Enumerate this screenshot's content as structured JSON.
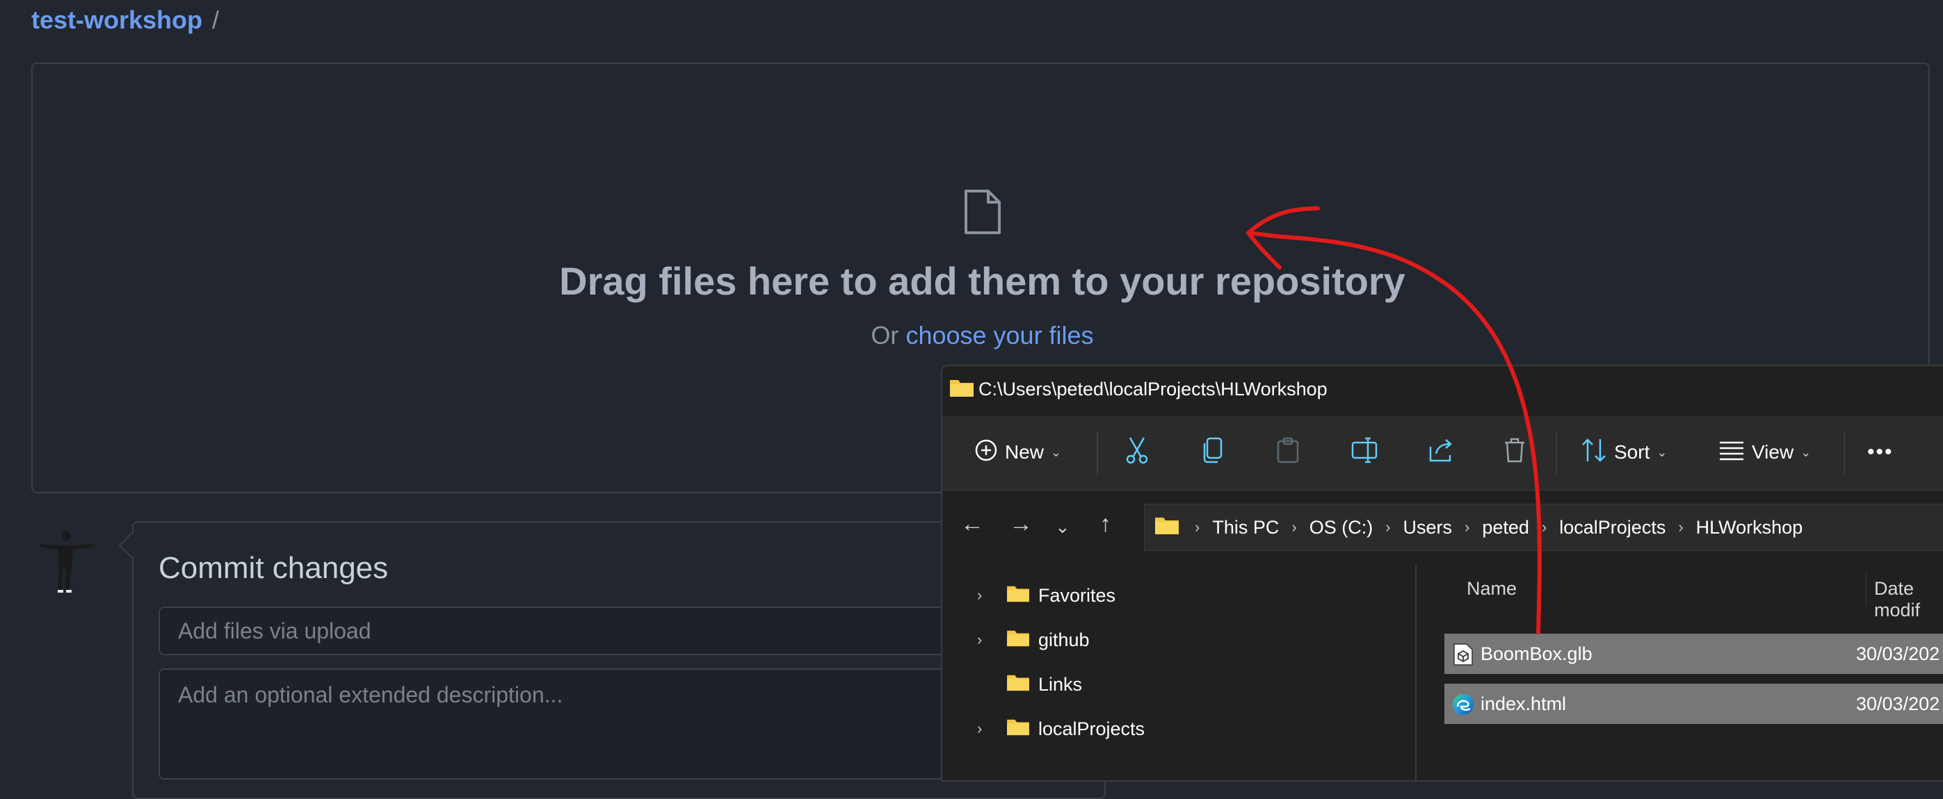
{
  "breadcrumb": {
    "repo": "test-workshop",
    "separator": "/"
  },
  "dropzone": {
    "title": "Drag files here to add them to your repository",
    "sub_prefix": "Or",
    "sub_link": "choose your files"
  },
  "commit": {
    "title": "Commit changes",
    "summary_placeholder": "Add files via upload",
    "description_placeholder": "Add an optional extended description..."
  },
  "explorer": {
    "title": "C:\\Users\\peted\\localProjects\\HLWorkshop",
    "toolbar": {
      "new_label": "New",
      "sort_label": "Sort",
      "view_label": "View",
      "more_label": "•••"
    },
    "address": [
      "This PC",
      "OS (C:)",
      "Users",
      "peted",
      "localProjects",
      "HLWorkshop"
    ],
    "tree": [
      {
        "label": "Favorites",
        "expandable": true
      },
      {
        "label": "github",
        "expandable": true
      },
      {
        "label": "Links",
        "expandable": false
      },
      {
        "label": "localProjects",
        "expandable": true
      }
    ],
    "columns": {
      "name": "Name",
      "date": "Date modif"
    },
    "files": [
      {
        "name": "BoomBox.glb",
        "date": "30/03/202",
        "icon": "3d-object-icon"
      },
      {
        "name": "index.html",
        "date": "30/03/202",
        "icon": "edge-browser-icon"
      }
    ]
  },
  "colors": {
    "background": "#22262e",
    "link": "#6c9cf0",
    "explorer_bg": "#202020",
    "selected_row": "#777777",
    "annotation": "#e01b1b",
    "folder": "#f5c842"
  }
}
